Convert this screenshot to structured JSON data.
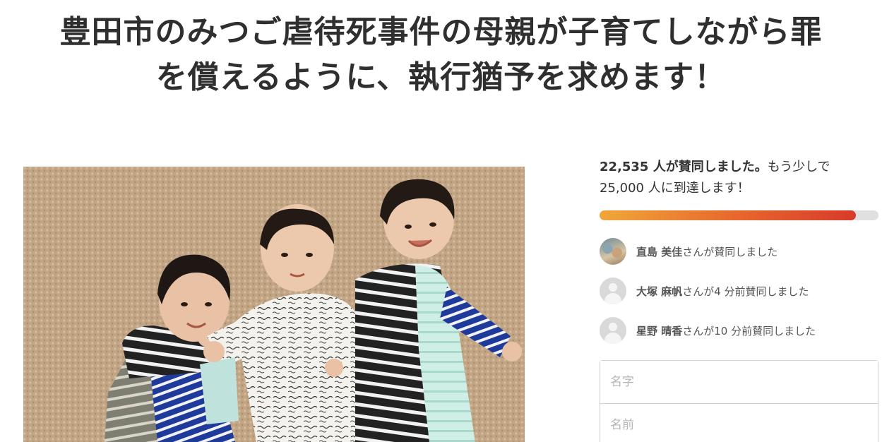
{
  "petition": {
    "title_line1": "豊田市のみつご虐待死事件の母親が子育てしながら罪",
    "title_line2": "を償えるように、執行猶予を求めます！"
  },
  "signature_count": {
    "bold_text": "22,535 人が賛同しました。",
    "rest_line1": "もう少しで",
    "rest_line2": "25,000 人に到達します！",
    "signed": 22535,
    "goal": 25000
  },
  "progress": {
    "fraction": 0.92
  },
  "recent_signers": [
    {
      "name": "直島 美佳",
      "suffix": "さんが賛同しました",
      "avatar": "user-photo"
    },
    {
      "name": "大塚 麻帆",
      "suffix": "さんが4 分前賛同しました",
      "avatar": "default-avatar-icon"
    },
    {
      "name": "星野 晴香",
      "suffix": "さんが10 分前賛同しました",
      "avatar": "default-avatar-icon"
    }
  ],
  "form": {
    "last_name_placeholder": "名字",
    "first_name_placeholder": "名前"
  },
  "colors": {
    "progress_start": "#f0a73a",
    "progress_end": "#d83a2a",
    "progress_track": "#e0e0e0"
  }
}
